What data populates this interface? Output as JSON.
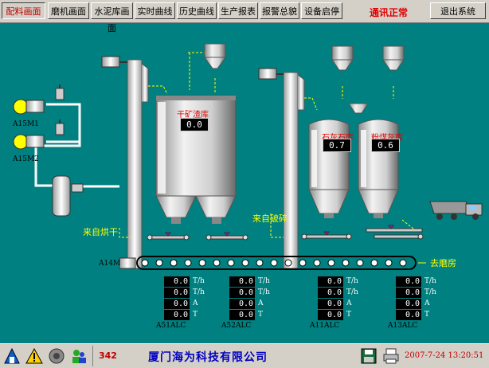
{
  "nav": {
    "buttons": [
      "配料画面",
      "磨机画面",
      "水泥库画面",
      "实时曲线",
      "历史曲线",
      "生产报表",
      "报警总貌",
      "设备启停"
    ],
    "status": "通讯正常",
    "exit": "退出系统"
  },
  "process": {
    "pumps": [
      "A15M1",
      "A15M2"
    ],
    "tanks": [
      {
        "name": "干矿渣库",
        "value": "0.0"
      },
      {
        "name": "石灰石库",
        "value": "0.7"
      },
      {
        "name": "粉煤灰库",
        "value": "0.6"
      }
    ],
    "labels": {
      "from_dryer": "来自烘干",
      "from_crusher": "来自破碎",
      "to_mill": "去磨房",
      "conveyor": "A14M"
    },
    "groups": [
      {
        "name": "A51ALC",
        "rows": [
          {
            "value": "0.0",
            "unit": "T/h"
          },
          {
            "value": "0.0",
            "unit": "T/h"
          },
          {
            "value": "0.0",
            "unit": "A"
          },
          {
            "value": "0.0",
            "unit": "T"
          }
        ]
      },
      {
        "name": "A52ALC",
        "rows": [
          {
            "value": "0.0",
            "unit": "T/h"
          },
          {
            "value": "0.0",
            "unit": "T/h"
          },
          {
            "value": "0.0",
            "unit": "A"
          },
          {
            "value": "0.0",
            "unit": "T"
          }
        ]
      },
      {
        "name": "A11ALC",
        "rows": [
          {
            "value": "0.0",
            "unit": "T/h"
          },
          {
            "value": "0.0",
            "unit": "T/h"
          },
          {
            "value": "0.0",
            "unit": "A"
          },
          {
            "value": "0.0",
            "unit": "T"
          }
        ]
      },
      {
        "name": "A13ALC",
        "rows": [
          {
            "value": "0.0",
            "unit": "T/h"
          },
          {
            "value": "0.0",
            "unit": "T/h"
          },
          {
            "value": "0.0",
            "unit": "A"
          },
          {
            "value": "0.0",
            "unit": "T"
          }
        ]
      }
    ]
  },
  "footer": {
    "count": "342",
    "company": "厦门海为科技有限公司",
    "datetime": "2007-7-24 13:20:51",
    "icons": [
      "home-icon",
      "warning-icon",
      "speaker-icon",
      "users-icon",
      "save-icon",
      "printer-icon"
    ]
  }
}
